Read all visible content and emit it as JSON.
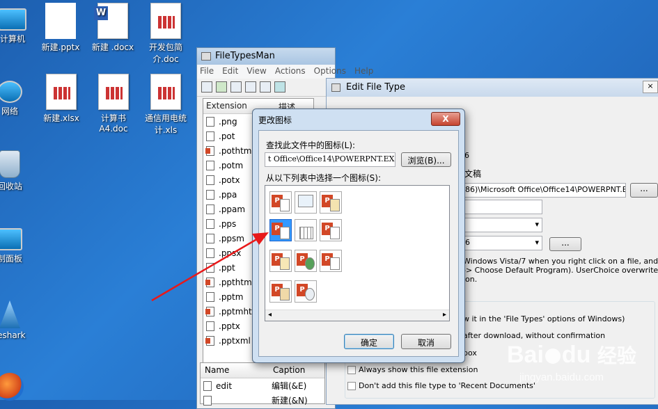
{
  "desktop": {
    "icons": [
      {
        "label": "计算机"
      },
      {
        "label": "新建.pptx"
      },
      {
        "label": "新建 .docx"
      },
      {
        "label": "开发包简介.doc"
      },
      {
        "label": "网络"
      },
      {
        "label": "新建.xlsx"
      },
      {
        "label": "计算书A4.doc"
      },
      {
        "label": "通信用电统计.xls"
      },
      {
        "label": "回收站"
      },
      {
        "label": "制面板"
      },
      {
        "label": "reshark"
      }
    ]
  },
  "ftm": {
    "title": "FileTypesMan",
    "menu": [
      "File",
      "Edit",
      "View",
      "Actions",
      "Options",
      "Help"
    ],
    "col_extension": "Extension",
    "col_desc": "描述",
    "extensions": [
      ".png",
      ".pot",
      ".pothtml",
      ".potm",
      ".potx",
      ".ppa",
      ".ppam",
      ".pps",
      ".ppsm",
      ".ppsx",
      ".ppt",
      ".ppthtml",
      ".pptm",
      ".pptmhtml",
      ".pptx",
      ".pptxml"
    ],
    "bottom_col_name": "Name",
    "bottom_col_caption": "Caption",
    "actions": [
      {
        "name": "edit",
        "caption": "编辑(&E)"
      },
      {
        "name": "",
        "caption": "新建(&N)"
      }
    ]
  },
  "eft": {
    "title": "Edit File Type",
    "type_text": "6",
    "desc_text": "文稿",
    "icon_path": "86)\\Microsoft Office\\Office14\\POWERPNT.EXE",
    "browse_small": "...",
    "combo2": "6",
    "btn_small2": "...",
    "note_line1": "Windows Vista/7 when you right click on a file, and",
    "note_line2": "-> Choose Default Program). UserChoice overwrites",
    "note_line3": "ion.",
    "opt1": "w it in the 'File Types' options of Windows)",
    "opt2": "after download, without confirmation",
    "opt3": "box",
    "opt4": "Always show this file extension",
    "opt5": "Don't add this file type to 'Recent Documents'"
  },
  "dialog": {
    "title": "更改图标",
    "close": "X",
    "find_label": "查找此文件中的图标(L):",
    "path_value": "t Office\\Office14\\POWERPNT.EXE",
    "browse": "浏览(B)...",
    "list_label": "从以下列表中选择一个图标(S):",
    "ok": "确定",
    "cancel": "取消"
  },
  "watermark": {
    "brand": "Bai",
    "paw": "du",
    "cn": "经验",
    "url": "jingyan.baidu.com"
  },
  "colors": {
    "accent": "#3399ff",
    "arrow": "#e8191a",
    "ppt": "#d24726"
  }
}
